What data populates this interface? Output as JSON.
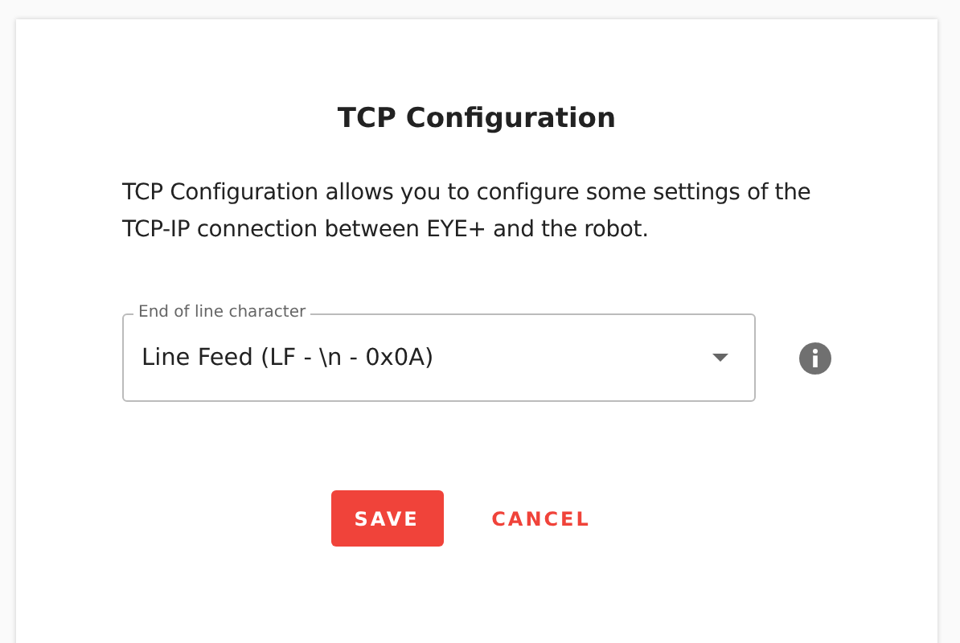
{
  "dialog": {
    "title": "TCP Configuration",
    "description": "TCP Configuration allows you to configure some settings of the TCP-IP connection between EYE+ and the robot.",
    "field": {
      "label": "End of line character",
      "value": "Line Feed (LF - \\n - 0x0A)"
    },
    "buttons": [
      {
        "label": "SAVE",
        "kind": "primary"
      },
      {
        "label": "CANCEL",
        "kind": "text"
      }
    ]
  }
}
